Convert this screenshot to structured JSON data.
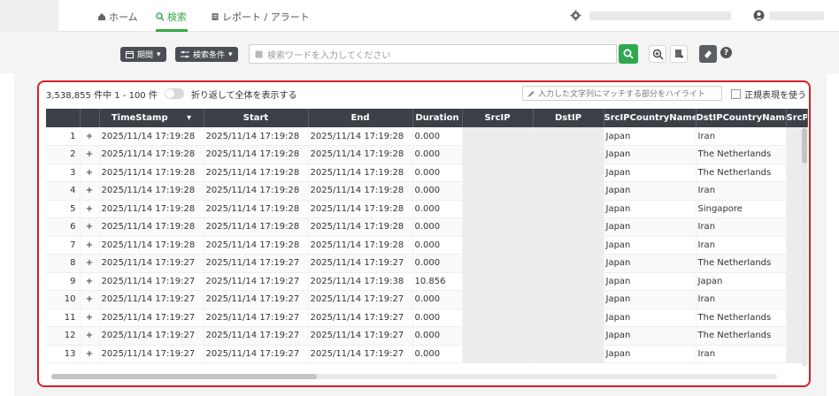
{
  "nav": {
    "home": "ホーム",
    "search": "検索",
    "reports": "レポート / アラート"
  },
  "toolbar": {
    "period": "期間",
    "conditions": "検索条件",
    "search_placeholder": "検索ワードを入力してください"
  },
  "results": {
    "count_text": "3,538,855 件中 1 - 100 件",
    "wrap_toggle_label": "折り返して全体を表示する",
    "highlight_placeholder": "入力した文字列にマッチする部分をハイライト",
    "regex_label": "正規表現を使う"
  },
  "table": {
    "columns": [
      "",
      "",
      "TimeStamp",
      "Start",
      "End",
      "Duration",
      "SrcIP",
      "DstIP",
      "SrcIPCountryName",
      "DstIPCountryName",
      "SrcPort"
    ],
    "rows": [
      {
        "n": "1",
        "ts": "2025/11/14 17:19:28",
        "start": "2025/11/14 17:19:28",
        "end": "2025/11/14 17:19:28",
        "dur": "0.000",
        "src_country": "Japan",
        "dst_country": "Iran"
      },
      {
        "n": "2",
        "ts": "2025/11/14 17:19:28",
        "start": "2025/11/14 17:19:28",
        "end": "2025/11/14 17:19:28",
        "dur": "0.000",
        "src_country": "Japan",
        "dst_country": "The Netherlands"
      },
      {
        "n": "3",
        "ts": "2025/11/14 17:19:28",
        "start": "2025/11/14 17:19:28",
        "end": "2025/11/14 17:19:28",
        "dur": "0.000",
        "src_country": "Japan",
        "dst_country": "The Netherlands"
      },
      {
        "n": "4",
        "ts": "2025/11/14 17:19:28",
        "start": "2025/11/14 17:19:28",
        "end": "2025/11/14 17:19:28",
        "dur": "0.000",
        "src_country": "Japan",
        "dst_country": "Iran"
      },
      {
        "n": "5",
        "ts": "2025/11/14 17:19:28",
        "start": "2025/11/14 17:19:28",
        "end": "2025/11/14 17:19:28",
        "dur": "0.000",
        "src_country": "Japan",
        "dst_country": "Singapore"
      },
      {
        "n": "6",
        "ts": "2025/11/14 17:19:28",
        "start": "2025/11/14 17:19:28",
        "end": "2025/11/14 17:19:28",
        "dur": "0.000",
        "src_country": "Japan",
        "dst_country": "Iran"
      },
      {
        "n": "7",
        "ts": "2025/11/14 17:19:28",
        "start": "2025/11/14 17:19:28",
        "end": "2025/11/14 17:19:28",
        "dur": "0.000",
        "src_country": "Japan",
        "dst_country": "Iran"
      },
      {
        "n": "8",
        "ts": "2025/11/14 17:19:27",
        "start": "2025/11/14 17:19:27",
        "end": "2025/11/14 17:19:27",
        "dur": "0.000",
        "src_country": "Japan",
        "dst_country": "The Netherlands"
      },
      {
        "n": "9",
        "ts": "2025/11/14 17:19:27",
        "start": "2025/11/14 17:19:27",
        "end": "2025/11/14 17:19:38",
        "dur": "10.856",
        "src_country": "Japan",
        "dst_country": "Japan"
      },
      {
        "n": "10",
        "ts": "2025/11/14 17:19:27",
        "start": "2025/11/14 17:19:27",
        "end": "2025/11/14 17:19:27",
        "dur": "0.000",
        "src_country": "Japan",
        "dst_country": "Iran"
      },
      {
        "n": "11",
        "ts": "2025/11/14 17:19:27",
        "start": "2025/11/14 17:19:27",
        "end": "2025/11/14 17:19:27",
        "dur": "0.000",
        "src_country": "Japan",
        "dst_country": "The Netherlands"
      },
      {
        "n": "12",
        "ts": "2025/11/14 17:19:27",
        "start": "2025/11/14 17:19:27",
        "end": "2025/11/14 17:19:27",
        "dur": "0.000",
        "src_country": "Japan",
        "dst_country": "The Netherlands"
      },
      {
        "n": "13",
        "ts": "2025/11/14 17:19:27",
        "start": "2025/11/14 17:19:27",
        "end": "2025/11/14 17:19:27",
        "dur": "0.000",
        "src_country": "Japan",
        "dst_country": "Iran"
      }
    ]
  },
  "colors": {
    "accent_green": "#2fa84f",
    "highlight_red": "#d61f26",
    "header_dark": "#3d4147"
  }
}
